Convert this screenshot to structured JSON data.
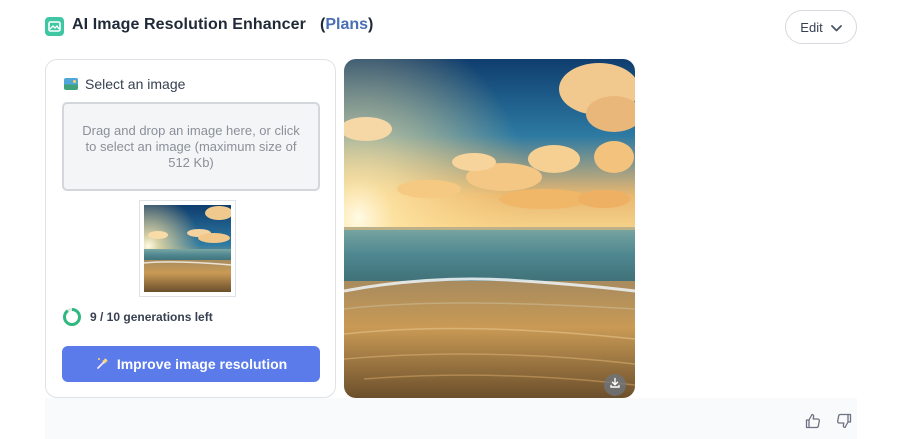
{
  "header": {
    "title": "AI Image Resolution Enhancer",
    "plans_open": "(",
    "plans_link": "Plans",
    "plans_close": ")",
    "edit_label": "Edit"
  },
  "form": {
    "select_label": "Select an image",
    "dropzone_text": "Drag and drop an image here, or click to select an image (maximum size of 512 Kb)",
    "quota_text": "9 / 10 generations left",
    "quota_fraction": 0.9,
    "improve_label": "Improve image resolution"
  },
  "icons": {
    "app": "enhancer-app-icon",
    "select": "image-icon",
    "edit": "chevron-down-icon",
    "improve": "magic-wand-icon",
    "download": "download-icon",
    "like": "thumbs-up-icon",
    "dislike": "thumbs-down-icon",
    "quota": "progress-ring-icon"
  },
  "colors": {
    "accent": "#5b7bea",
    "link": "#4a6fb5",
    "app_icon": "#3fc7a3",
    "quota_ring": "#2fb87f"
  }
}
